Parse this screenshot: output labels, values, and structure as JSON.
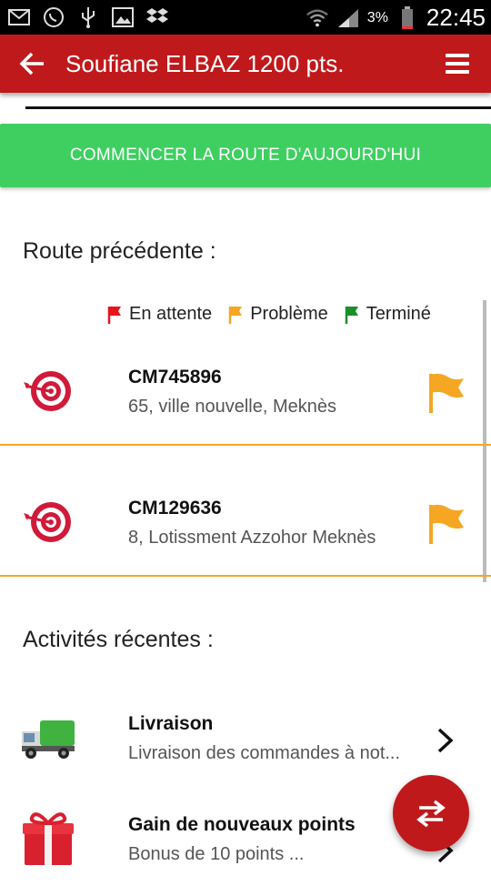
{
  "status_bar": {
    "battery_percent": "3%",
    "time": "22:45",
    "icons": [
      "mail-icon",
      "whatsapp-icon",
      "usb-icon",
      "image-icon",
      "dropbox-icon",
      "wifi-icon",
      "signal-icon",
      "battery-icon"
    ]
  },
  "header": {
    "title": "Soufiane ELBAZ 1200 pts.",
    "color": "#c0191c"
  },
  "start_button": {
    "label": "COMMENCER LA ROUTE D'AUJOURD'HUI",
    "color": "#3ecf60"
  },
  "previous_route": {
    "title": "Route précédente :",
    "legend": [
      {
        "label": "En attente",
        "color": "#e8141b"
      },
      {
        "label": "Problème",
        "color": "#f5a623"
      },
      {
        "label": "Terminé",
        "color": "#1a8f2a"
      }
    ],
    "items": [
      {
        "code": "CM745896",
        "address": "65, ville nouvelle, Meknès",
        "status_color": "#f5a623"
      },
      {
        "code": "CM129636",
        "address": "8, Lotissment Azzohor Meknès",
        "status_color": "#f5a623"
      }
    ]
  },
  "recent_activities": {
    "title": "Activités récentes :",
    "items": [
      {
        "title": "Livraison",
        "subtitle": "Livraison des commandes à not..."
      },
      {
        "title": "Gain de nouveaux points",
        "subtitle": "Bonus de 10 points ..."
      }
    ]
  }
}
